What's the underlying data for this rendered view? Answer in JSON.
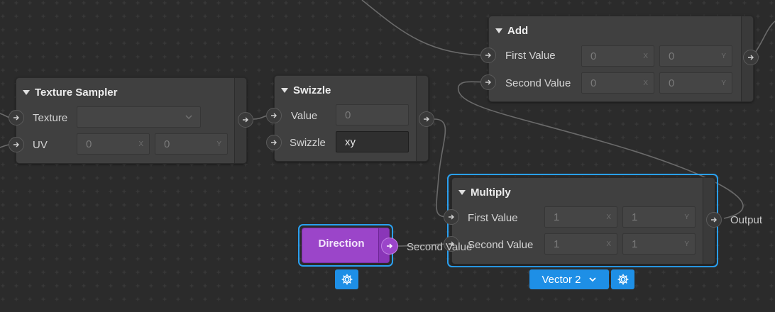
{
  "nodes": {
    "texture_sampler": {
      "title": "Texture Sampler",
      "texture_label": "Texture",
      "uv_label": "UV",
      "uv_x": "0",
      "uv_x_axis": "X",
      "uv_y": "0",
      "uv_y_axis": "Y"
    },
    "swizzle": {
      "title": "Swizzle",
      "value_label": "Value",
      "value": "0",
      "swizzle_label": "Swizzle",
      "swizzle_value": "xy"
    },
    "add": {
      "title": "Add",
      "first_label": "First Value",
      "first_x": "0",
      "first_y": "0",
      "second_label": "Second Value",
      "second_x": "0",
      "second_y": "0",
      "x_axis": "X",
      "y_axis": "Y"
    },
    "multiply": {
      "title": "Multiply",
      "first_label": "First Value",
      "first_x": "1",
      "first_y": "1",
      "second_label": "Second Value",
      "second_x": "1",
      "second_y": "1",
      "x_axis": "X",
      "y_axis": "Y",
      "output_label": "Output"
    },
    "direction": {
      "title": "Direction",
      "connection_label": "Second Value"
    }
  },
  "type_selector": {
    "label": "Vector 2"
  },
  "icons": {
    "port": "arrow-right-icon",
    "settings": "gear-icon",
    "dropdown": "chevron-down-icon",
    "collapse": "triangle-down-icon"
  },
  "colors": {
    "accent": "#2aa0f0",
    "direction_node": "#9b45c9",
    "background": "#2b2b2b",
    "node": "#404040"
  }
}
